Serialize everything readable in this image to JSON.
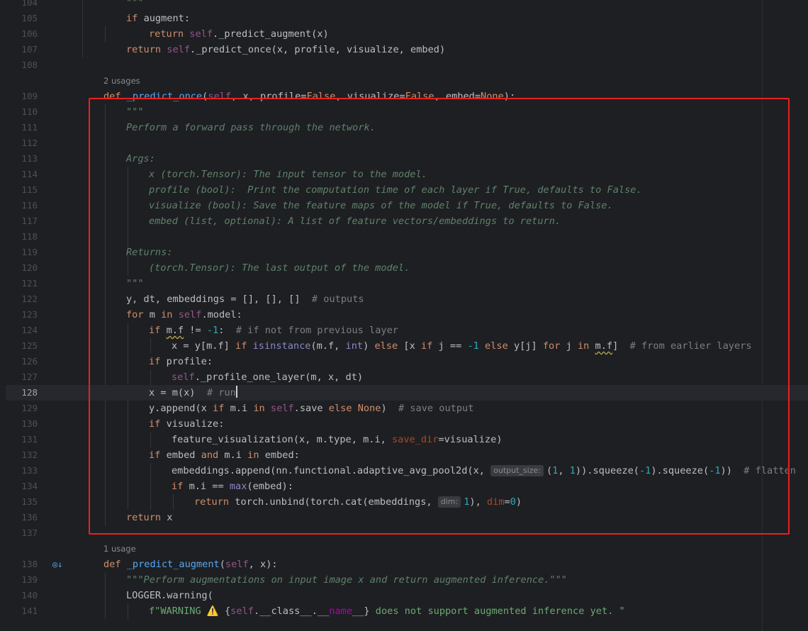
{
  "editor": {
    "current_line": 128,
    "usages": [
      {
        "before_line": 109,
        "text": "2 usages"
      },
      {
        "before_line": 138,
        "text": "1 usage"
      }
    ],
    "lines": [
      {
        "n": 104,
        "indent": 1,
        "tokens": [
          [
            "doc",
            "\"\"\""
          ]
        ]
      },
      {
        "n": 105,
        "indent": 1,
        "tokens": [
          [
            "kw",
            "if "
          ],
          [
            "id",
            "augment:"
          ]
        ]
      },
      {
        "n": 106,
        "indent": 2,
        "tokens": [
          [
            "kw",
            "return "
          ],
          [
            "self",
            "self"
          ],
          [
            "id",
            "._predict_augment(x)"
          ]
        ]
      },
      {
        "n": 107,
        "indent": 1,
        "tokens": [
          [
            "kw",
            "return "
          ],
          [
            "self",
            "self"
          ],
          [
            "id",
            "._predict_once(x, profile, visualize, embed)"
          ]
        ]
      },
      {
        "n": 108,
        "indent": 0,
        "tokens": []
      },
      {
        "n": 109,
        "indent": 0,
        "tokens": [
          [
            "kw",
            "def "
          ],
          [
            "fn",
            "_predict_once"
          ],
          [
            "id",
            "("
          ],
          [
            "self",
            "self"
          ],
          [
            "id",
            ", x, profile="
          ],
          [
            "kw",
            "False"
          ],
          [
            "id",
            ", visualize="
          ],
          [
            "kw",
            "False"
          ],
          [
            "id",
            ", embed="
          ],
          [
            "kw",
            "None"
          ],
          [
            "id",
            "):"
          ]
        ]
      },
      {
        "n": 110,
        "indent": 1,
        "tokens": [
          [
            "doc",
            "\"\"\""
          ]
        ]
      },
      {
        "n": 111,
        "indent": 1,
        "tokens": [
          [
            "doc",
            "Perform a forward pass through the network."
          ]
        ]
      },
      {
        "n": 112,
        "indent": 0,
        "tokens": []
      },
      {
        "n": 113,
        "indent": 1,
        "tokens": [
          [
            "doc",
            "Args:"
          ]
        ]
      },
      {
        "n": 114,
        "indent": 2,
        "tokens": [
          [
            "doc",
            "x (torch.Tensor): The input tensor to the model."
          ]
        ]
      },
      {
        "n": 115,
        "indent": 2,
        "tokens": [
          [
            "doc",
            "profile (bool):  Print the computation time of each layer if True, defaults to False."
          ]
        ]
      },
      {
        "n": 116,
        "indent": 2,
        "tokens": [
          [
            "doc",
            "visualize (bool): Save the feature maps of the model if True, defaults to False."
          ]
        ]
      },
      {
        "n": 117,
        "indent": 2,
        "tokens": [
          [
            "doc",
            "embed (list, optional): A list of feature vectors/embeddings to return."
          ]
        ]
      },
      {
        "n": 118,
        "indent": 0,
        "tokens": []
      },
      {
        "n": 119,
        "indent": 1,
        "tokens": [
          [
            "doc",
            "Returns:"
          ]
        ]
      },
      {
        "n": 120,
        "indent": 2,
        "tokens": [
          [
            "doc",
            "(torch.Tensor): The last output of the model."
          ]
        ]
      },
      {
        "n": 121,
        "indent": 1,
        "tokens": [
          [
            "doc",
            "\"\"\""
          ]
        ]
      },
      {
        "n": 122,
        "indent": 1,
        "tokens": [
          [
            "id",
            "y, dt, embeddings = [], [], []  "
          ],
          [
            "cm",
            "# outputs"
          ]
        ]
      },
      {
        "n": 123,
        "indent": 1,
        "tokens": [
          [
            "kw",
            "for "
          ],
          [
            "id",
            "m "
          ],
          [
            "kw",
            "in "
          ],
          [
            "self",
            "self"
          ],
          [
            "id",
            ".model:"
          ]
        ]
      },
      {
        "n": 124,
        "indent": 2,
        "tokens": [
          [
            "kw",
            "if "
          ],
          [
            "squiggle",
            "m.f"
          ],
          [
            "id",
            " != "
          ],
          [
            "num",
            "-1"
          ],
          [
            "id",
            ":  "
          ],
          [
            "cm",
            "# if not from previous layer"
          ]
        ]
      },
      {
        "n": 125,
        "indent": 3,
        "tokens": [
          [
            "id",
            "x = y[m.f] "
          ],
          [
            "kw",
            "if "
          ],
          [
            "builtin",
            "isinstance"
          ],
          [
            "id",
            "(m.f, "
          ],
          [
            "builtin",
            "int"
          ],
          [
            "id",
            ") "
          ],
          [
            "kw",
            "else "
          ],
          [
            "id",
            "[x "
          ],
          [
            "kw",
            "if "
          ],
          [
            "id",
            "j == "
          ],
          [
            "num",
            "-1"
          ],
          [
            "kw",
            " else "
          ],
          [
            "id",
            "y[j] "
          ],
          [
            "kw",
            "for "
          ],
          [
            "id",
            "j "
          ],
          [
            "kw",
            "in "
          ],
          [
            "squiggle",
            "m.f"
          ],
          [
            "id",
            "]  "
          ],
          [
            "cm",
            "# from earlier layers"
          ]
        ]
      },
      {
        "n": 126,
        "indent": 2,
        "tokens": [
          [
            "kw",
            "if "
          ],
          [
            "id",
            "profile:"
          ]
        ]
      },
      {
        "n": 127,
        "indent": 3,
        "tokens": [
          [
            "self",
            "self"
          ],
          [
            "id",
            "._profile_one_layer(m, x, dt)"
          ]
        ]
      },
      {
        "n": 128,
        "indent": 2,
        "tokens": [
          [
            "id",
            "x = m(x)  "
          ],
          [
            "cm",
            "# run"
          ],
          [
            "caret",
            ""
          ]
        ]
      },
      {
        "n": 129,
        "indent": 2,
        "tokens": [
          [
            "id",
            "y.append(x "
          ],
          [
            "kw",
            "if "
          ],
          [
            "id",
            "m.i "
          ],
          [
            "kw",
            "in "
          ],
          [
            "self",
            "self"
          ],
          [
            "id",
            ".save "
          ],
          [
            "kw",
            "else "
          ],
          [
            "kw",
            "None"
          ],
          [
            "id",
            ")  "
          ],
          [
            "cm",
            "# save output"
          ]
        ]
      },
      {
        "n": 130,
        "indent": 2,
        "tokens": [
          [
            "kw",
            "if "
          ],
          [
            "id",
            "visualize:"
          ]
        ]
      },
      {
        "n": 131,
        "indent": 3,
        "tokens": [
          [
            "id",
            "feature_visualization(x, m.type, m.i, "
          ],
          [
            "param",
            "save_dir"
          ],
          [
            "id",
            "=visualize)"
          ]
        ]
      },
      {
        "n": 132,
        "indent": 2,
        "tokens": [
          [
            "kw",
            "if "
          ],
          [
            "id",
            "embed "
          ],
          [
            "kw",
            "and "
          ],
          [
            "id",
            "m.i "
          ],
          [
            "kw",
            "in "
          ],
          [
            "id",
            "embed:"
          ]
        ]
      },
      {
        "n": 133,
        "indent": 3,
        "tokens": [
          [
            "id",
            "embeddings.append(nn.functional.adaptive_avg_pool2d(x, "
          ],
          [
            "hint",
            "output_size:"
          ],
          [
            "id",
            "("
          ],
          [
            "num",
            "1"
          ],
          [
            "id",
            ", "
          ],
          [
            "num",
            "1"
          ],
          [
            "id",
            ")).squeeze("
          ],
          [
            "num",
            "-1"
          ],
          [
            "id",
            ").squeeze("
          ],
          [
            "num",
            "-1"
          ],
          [
            "id",
            "))  "
          ],
          [
            "cm",
            "# flatten"
          ]
        ]
      },
      {
        "n": 134,
        "indent": 3,
        "tokens": [
          [
            "kw",
            "if "
          ],
          [
            "id",
            "m.i == "
          ],
          [
            "builtin",
            "max"
          ],
          [
            "id",
            "(embed):"
          ]
        ]
      },
      {
        "n": 135,
        "indent": 4,
        "tokens": [
          [
            "kw",
            "return "
          ],
          [
            "id",
            "torch.unbind(torch.cat(embeddings, "
          ],
          [
            "hint",
            "dim:"
          ],
          [
            "num",
            "1"
          ],
          [
            "id",
            "), "
          ],
          [
            "param",
            "dim"
          ],
          [
            "id",
            "="
          ],
          [
            "num",
            "0"
          ],
          [
            "id",
            ")"
          ]
        ]
      },
      {
        "n": 136,
        "indent": 1,
        "tokens": [
          [
            "kw",
            "return "
          ],
          [
            "id",
            "x"
          ]
        ]
      },
      {
        "n": 137,
        "indent": 0,
        "tokens": []
      },
      {
        "n": 138,
        "indent": 0,
        "tokens": [
          [
            "kw",
            "def "
          ],
          [
            "fn",
            "_predict_augment"
          ],
          [
            "id",
            "("
          ],
          [
            "self",
            "self"
          ],
          [
            "id",
            ", x):"
          ]
        ]
      },
      {
        "n": 139,
        "indent": 1,
        "tokens": [
          [
            "doc",
            "\"\"\"Perform augmentations on input image x and return augmented inference.\"\"\""
          ]
        ]
      },
      {
        "n": 140,
        "indent": 1,
        "tokens": [
          [
            "id",
            "LOGGER.warning("
          ]
        ]
      },
      {
        "n": 141,
        "indent": 2,
        "tokens": [
          [
            "str",
            "f\"WARNING ⚠️ "
          ],
          [
            "id",
            "{"
          ],
          [
            "self",
            "self"
          ],
          [
            "id",
            ".__class__.__"
          ],
          [
            "dunder",
            "name"
          ],
          [
            "id",
            "__}"
          ],
          [
            "str",
            " does not support augmented inference yet. \""
          ]
        ]
      }
    ]
  },
  "gutter": {
    "icon": "override-method-icon",
    "icon_line": 138
  },
  "highlight": {
    "color": "#e8211f",
    "from_line": 109,
    "to_line": 136
  }
}
